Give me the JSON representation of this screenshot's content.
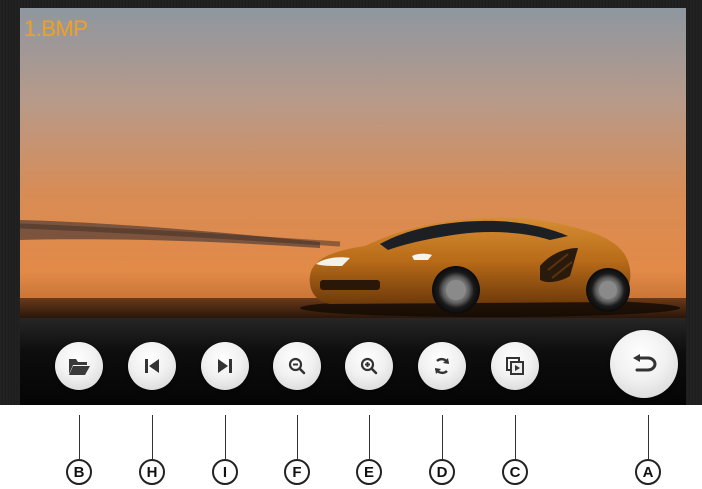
{
  "viewer": {
    "file_name": "1.BMP"
  },
  "toolbar": {
    "buttons": [
      {
        "name": "open-folder-button",
        "icon": "folder-open-icon"
      },
      {
        "name": "previous-button",
        "icon": "skip-previous-icon"
      },
      {
        "name": "next-button",
        "icon": "skip-next-icon"
      },
      {
        "name": "zoom-out-button",
        "icon": "zoom-out-icon"
      },
      {
        "name": "zoom-in-button",
        "icon": "zoom-in-icon"
      },
      {
        "name": "rotate-button",
        "icon": "rotate-icon"
      },
      {
        "name": "slideshow-button",
        "icon": "slideshow-icon"
      },
      {
        "name": "back-button",
        "icon": "return-arrow-icon"
      }
    ]
  },
  "callouts": {
    "b": "B",
    "h": "H",
    "i": "I",
    "f": "F",
    "e": "E",
    "d": "D",
    "c": "C",
    "a": "A"
  },
  "colors": {
    "file_name": "#f2a11f",
    "sky_top": "#8f99a3",
    "sky_bottom": "#d98a4a",
    "car_body": "#c77a1f"
  }
}
